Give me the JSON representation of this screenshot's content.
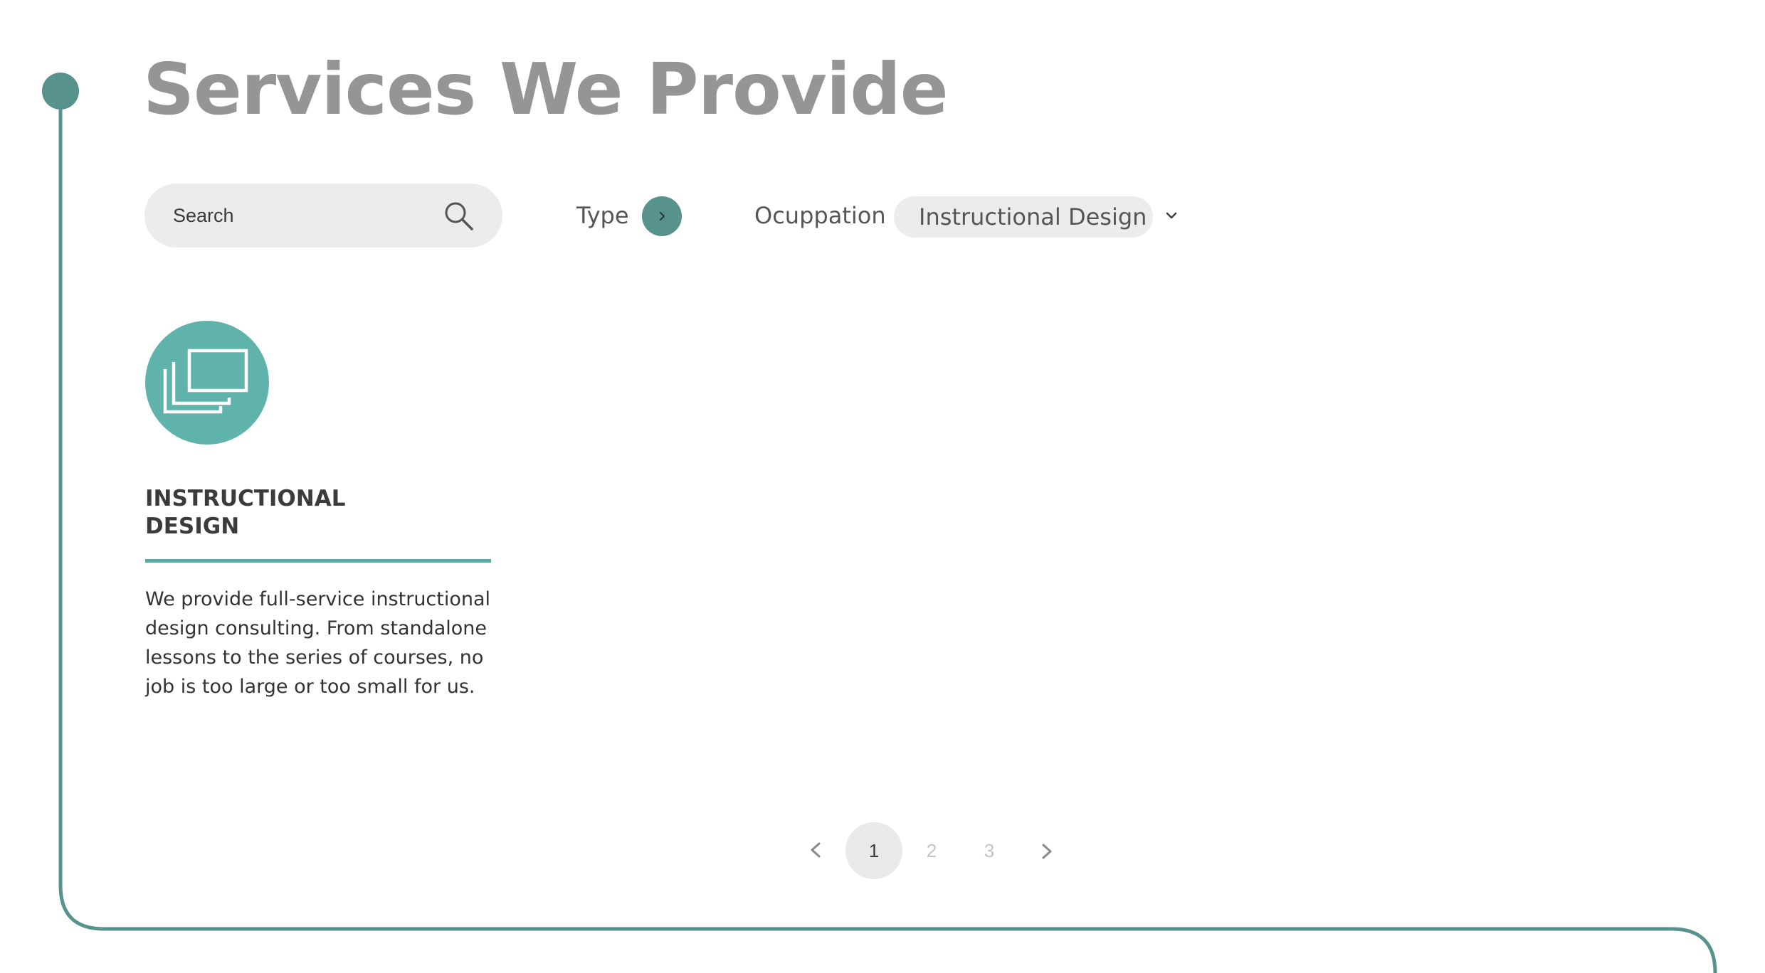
{
  "header": {
    "title": "Services We Provide"
  },
  "search": {
    "placeholder": "Search",
    "value": ""
  },
  "filters": {
    "type_label": "Type",
    "occupation_label": "Ocuppation",
    "occupation_value": "Instructional Design"
  },
  "services": [
    {
      "icon": "stacked-screens-icon",
      "title": "INSTRUCTIONAL DESIGN",
      "description": "We provide full-service instructional design consulting. From standalone lessons to the series of courses, no job is too large or too small for us."
    }
  ],
  "pagination": {
    "pages": [
      "1",
      "2",
      "3"
    ],
    "current": "1"
  },
  "colors": {
    "accent": "#57928d",
    "icon_circle": "#5fb3ab",
    "title": "#959595",
    "pill_bg": "#ececec"
  }
}
